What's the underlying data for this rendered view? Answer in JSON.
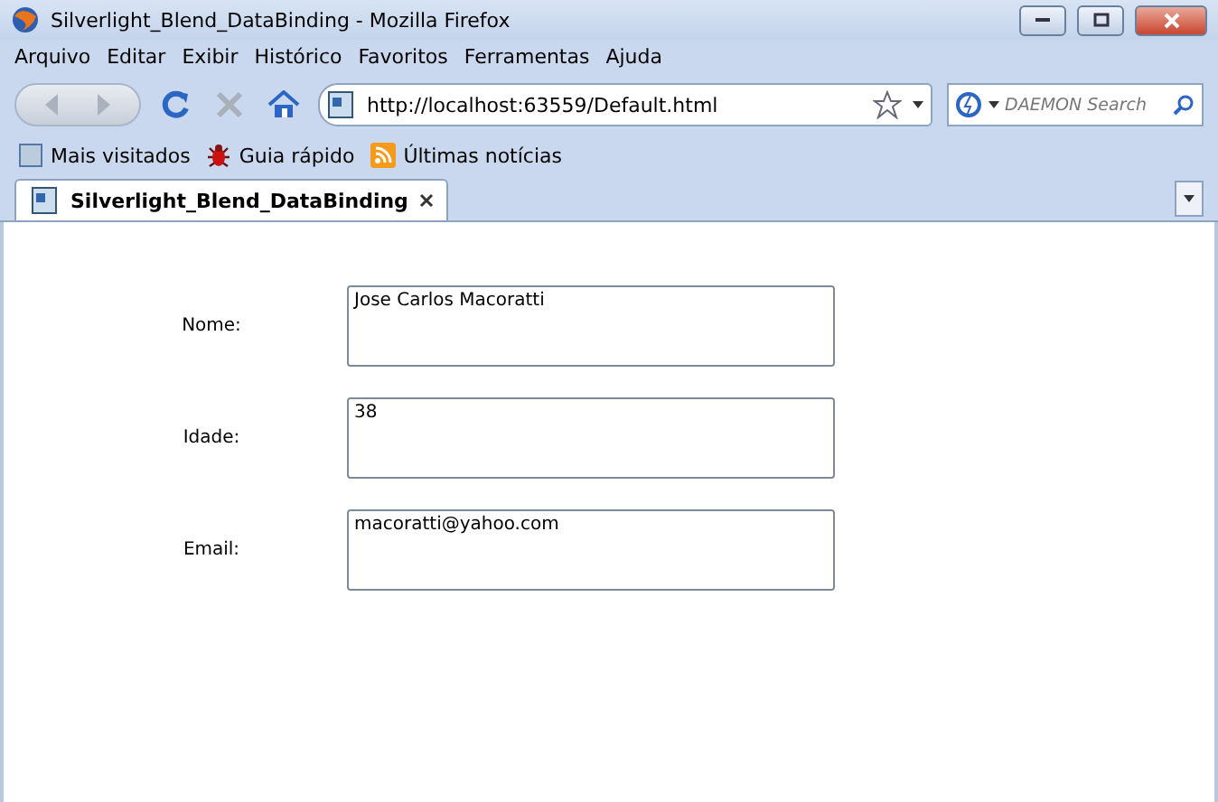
{
  "window": {
    "title": "Silverlight_Blend_DataBinding - Mozilla Firefox"
  },
  "menu": [
    "Arquivo",
    "Editar",
    "Exibir",
    "Histórico",
    "Favoritos",
    "Ferramentas",
    "Ajuda"
  ],
  "address": {
    "value": "http://localhost:63559/Default.html"
  },
  "search": {
    "placeholder": "DAEMON Search"
  },
  "bookmarks": [
    "Mais visitados",
    "Guia rápido",
    "Últimas notícias"
  ],
  "tabs": [
    {
      "label": "Silverlight_Blend_DataBinding",
      "selected": true
    }
  ],
  "form": [
    {
      "label": "Nome:",
      "value": "Jose Carlos Macoratti"
    },
    {
      "label": "Idade:",
      "value": "38"
    },
    {
      "label": "Email:",
      "value": "macoratti@yahoo.com"
    }
  ]
}
